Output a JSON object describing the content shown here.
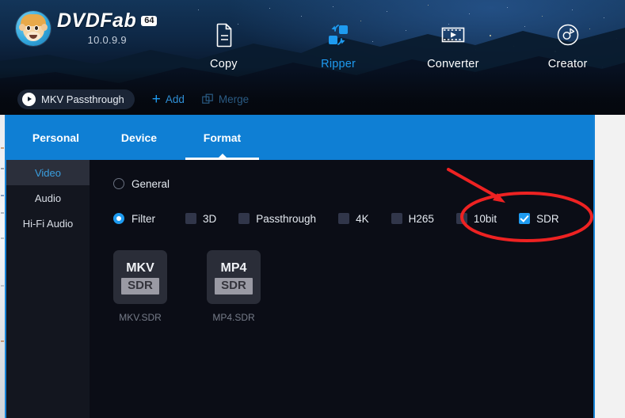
{
  "app": {
    "logo_title": "DVDFab",
    "logo_badge": "64",
    "version": "10.0.9.9"
  },
  "topnav": {
    "items": [
      {
        "label": "Copy",
        "icon": "document-copy-icon",
        "active": false
      },
      {
        "label": "Ripper",
        "icon": "ripper-convert-icon",
        "active": true
      },
      {
        "label": "Converter",
        "icon": "video-frame-icon",
        "active": false
      },
      {
        "label": "Creator",
        "icon": "disc-burn-icon",
        "active": false
      }
    ]
  },
  "toolbar": {
    "profile_pill": "MKV Passthrough",
    "profile_pill_icon": "arrow-right-circle-icon",
    "add_label": "Add",
    "add_icon": "plus-icon",
    "merge_label": "Merge",
    "merge_icon": "merge-squares-icon"
  },
  "tabs": [
    {
      "label": "Personal",
      "active": false
    },
    {
      "label": "Device",
      "active": false
    },
    {
      "label": "Format",
      "active": true
    }
  ],
  "sidebar": {
    "items": [
      {
        "label": "Video",
        "active": true
      },
      {
        "label": "Audio",
        "active": false
      },
      {
        "label": "Hi-Fi Audio",
        "active": false
      }
    ]
  },
  "filters": {
    "modes": [
      {
        "label": "General",
        "selected": false
      },
      {
        "label": "Filter",
        "selected": true
      }
    ],
    "checkboxes": [
      {
        "label": "3D",
        "checked": false
      },
      {
        "label": "Passthrough",
        "checked": false
      },
      {
        "label": "4K",
        "checked": false
      },
      {
        "label": "H265",
        "checked": false
      },
      {
        "label": "10bit",
        "checked": false
      },
      {
        "label": "SDR",
        "checked": true
      }
    ]
  },
  "formats": [
    {
      "top": "MKV",
      "sub": "SDR",
      "caption": "MKV.SDR"
    },
    {
      "top": "MP4",
      "sub": "SDR",
      "caption": "MP4.SDR"
    }
  ],
  "annotation": {
    "highlight_target": "SDR",
    "shape": "ellipse-and-arrow",
    "color": "#ee2222"
  },
  "colors": {
    "accent_blue": "#1e9bf0",
    "tab_blue": "#0f7fd4",
    "panel_bg": "#0b0d16",
    "sidebar_bg": "#13161f",
    "annotation_red": "#ee2222"
  }
}
